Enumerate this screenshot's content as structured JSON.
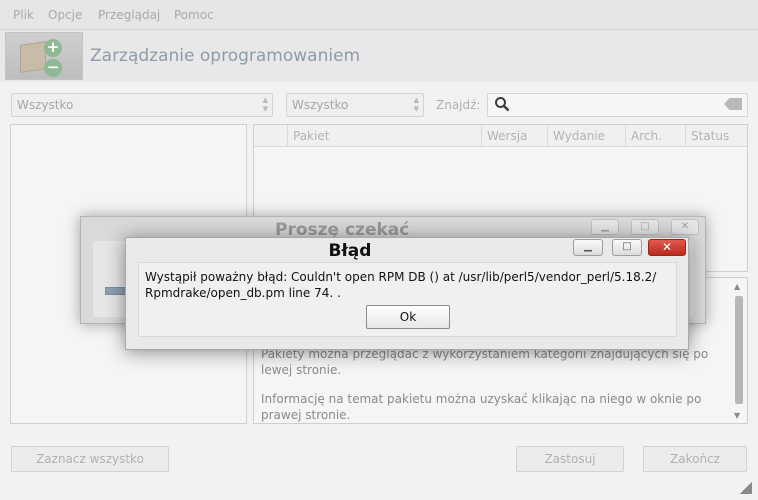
{
  "menubar": {
    "items": [
      "Plik",
      "Opcje",
      "Przeglądaj",
      "Pomoc"
    ]
  },
  "header": {
    "title": "Zarządzanie oprogramowaniem"
  },
  "filters": {
    "category": "Wszystko",
    "status": "Wszystko",
    "find_label": "Znajdź:",
    "search_value": ""
  },
  "table": {
    "columns": [
      "Pakiet",
      "Wersja",
      "Wydanie",
      "Arch.",
      "Status"
    ]
  },
  "info": {
    "line1": "Pakiety można przeglądać z wykorzystaniem kategorii znajdujących się po lewej stronie.",
    "line2": "Informację na temat pakietu można uzyskać klikając na niego w oknie po prawej stronie."
  },
  "buttons": {
    "select_all": "Zaznacz wszystko",
    "apply": "Zastosuj",
    "finish": "Zakończ"
  },
  "wait_dialog": {
    "title": "Proszę czekać"
  },
  "error_dialog": {
    "title": "Błąd",
    "message": "Wystąpił poważny błąd: Couldn't open RPM DB () at /usr/lib/perl5/vendor_perl/5.18.2/ Rpmdrake/open_db.pm line 74. .",
    "ok_label": "Ok"
  },
  "icons": [
    "package-add-remove-icon",
    "search-icon",
    "clear-icon",
    "minimize-icon",
    "maximize-icon",
    "close-icon"
  ],
  "colors": {
    "close_button": "#c93a2c",
    "title_dim": "#8d9bab"
  }
}
